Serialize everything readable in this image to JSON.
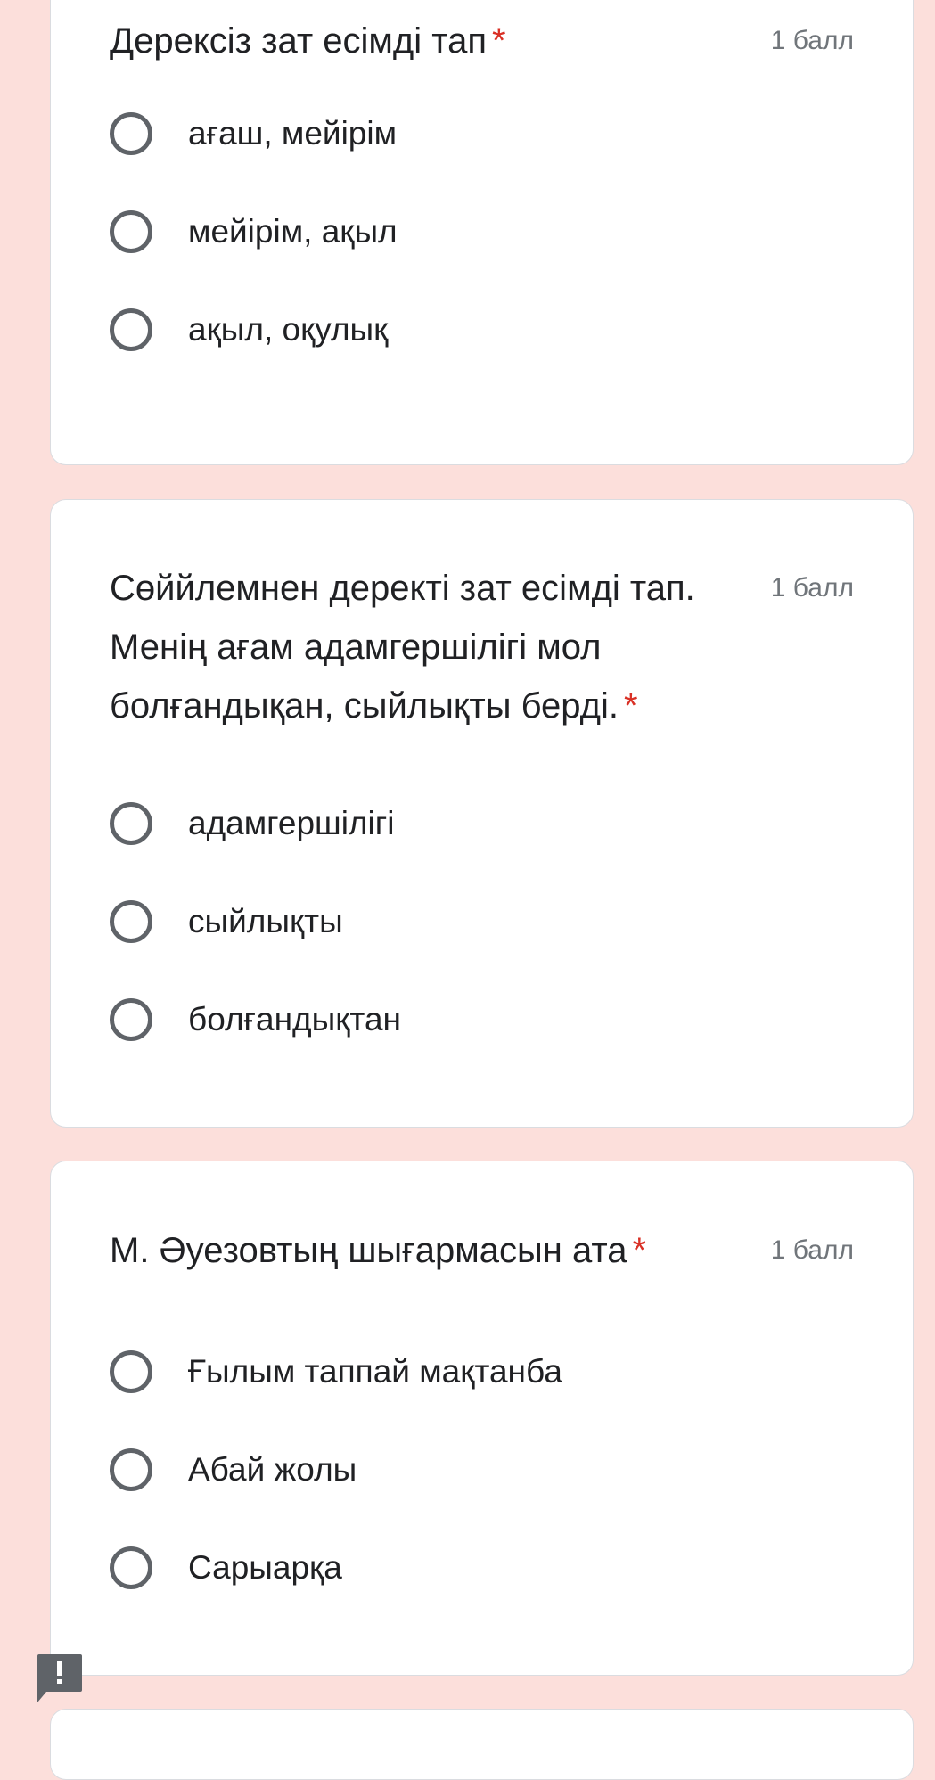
{
  "questions": [
    {
      "title": "Дерексіз зат есімді тап",
      "required_mark": "*",
      "points": "1 балл",
      "options": [
        "ағаш, мейірім",
        "мейірім, ақыл",
        "ақыл, оқулық"
      ]
    },
    {
      "title": "Сөййлемнен деректі зат есімді тап. Менің ағам адамгершілігі мол болғандықан, сыйлықты берді.",
      "required_mark": "*",
      "points": "1 балл",
      "options": [
        "адамгершілігі",
        "сыйлықты",
        "болғандықтан"
      ]
    },
    {
      "title": "М. Әуезовтың шығармасын ата",
      "required_mark": "*",
      "points": "1 балл",
      "options": [
        "Ғылым таппай мақтанба",
        "Абай жолы",
        "Сарыарқа"
      ]
    }
  ],
  "colors": {
    "page_background": "#fcdfdb",
    "card_background": "#ffffff",
    "required_mark": "#d93025",
    "radio_border": "#5f6368",
    "points_text": "#70757a",
    "report_button": "#5f6368"
  },
  "report_button": {
    "icon": "exclamation-icon"
  }
}
